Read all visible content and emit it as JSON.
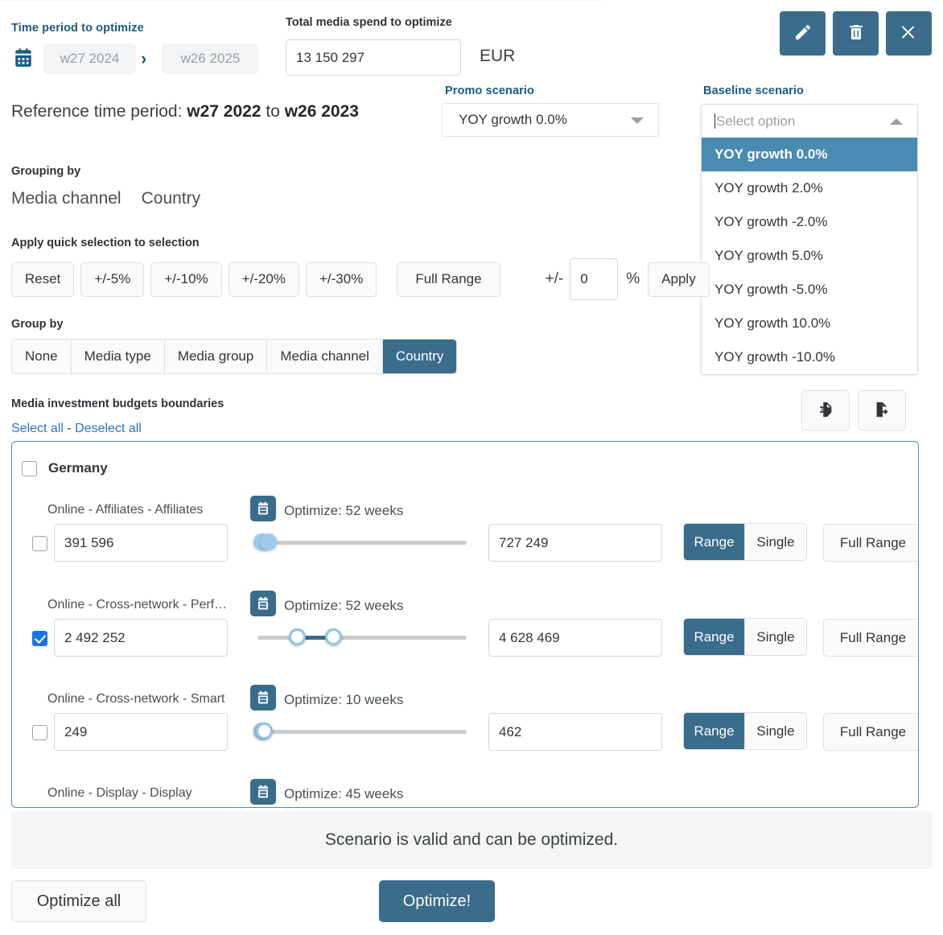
{
  "colors": {
    "accent": "#3a6c8b",
    "accent_light": "#4a8bb1",
    "label_blue": "#1b5b80",
    "link_blue": "#2277cc",
    "checkbox_blue": "#1a73e8",
    "handle_blue": "#8fc4e8"
  },
  "top_actions": [
    {
      "name": "edit-scenario-button",
      "icon": "pencil-icon"
    },
    {
      "name": "delete-scenario-button",
      "icon": "trash-icon"
    },
    {
      "name": "close-button",
      "icon": "close-icon"
    }
  ],
  "time_period": {
    "label": "Time period to optimize",
    "start": "w27 2024",
    "end": "w26 2025",
    "separator": "›",
    "calendar_icon": "calendar-icon",
    "reference_prefix": "Reference time period: ",
    "reference_start": "w27 2022",
    "reference_middle": " to ",
    "reference_end": "w26 2023"
  },
  "spend": {
    "label": "Total media spend to optimize",
    "value": "13 150 297",
    "currency": "EUR"
  },
  "promo": {
    "label": "Promo scenario",
    "value": "YOY growth 0.0%"
  },
  "baseline": {
    "label": "Baseline scenario",
    "placeholder": "Select option",
    "selected_index": 0,
    "options": [
      "YOY growth 0.0%",
      "YOY growth 2.0%",
      "YOY growth -2.0%",
      "YOY growth 5.0%",
      "YOY growth -5.0%",
      "YOY growth 10.0%",
      "YOY growth -10.0%"
    ]
  },
  "grouping": {
    "label": "Grouping by",
    "values": [
      "Media channel",
      "Country"
    ]
  },
  "quick_selection": {
    "label": "Apply quick selection to selection",
    "buttons": [
      "Reset",
      "+/-5%",
      "+/-10%",
      "+/-20%",
      "+/-30%"
    ],
    "full_range_label": "Full Range",
    "pm_sign": "+/-",
    "pm_value": "0",
    "pm_percent": "%",
    "apply_label": "Apply"
  },
  "group_by": {
    "label": "Group by",
    "tabs": [
      "None",
      "Media type",
      "Media group",
      "Media channel",
      "Country"
    ],
    "active_index": 4
  },
  "budgets": {
    "title": "Media investment budgets boundaries",
    "select_all": "Select all",
    "separator": " - ",
    "deselect_all": "Deselect all",
    "import_icon": "import-document-icon",
    "export_icon": "export-document-icon",
    "country": "Germany",
    "country_checked": false,
    "range_label": "Range",
    "single_label": "Single",
    "full_range_label": "Full Range",
    "rows": [
      {
        "name": "Online - Affiliates - Affiliates",
        "optimize": "Optimize: 52 weeks",
        "min": "391 596",
        "max": "727 249",
        "checked": false,
        "mode": "Range",
        "slider_low_pct": 2,
        "slider_high_pct": 5
      },
      {
        "name": "Online - Cross-network - Perf…",
        "optimize": "Optimize: 52 weeks",
        "min": "2 492 252",
        "max": "4 628 469",
        "checked": true,
        "mode": "Range",
        "slider_low_pct": 19,
        "slider_high_pct": 36
      },
      {
        "name": "Online - Cross-network - Smart",
        "optimize": "Optimize: 10 weeks",
        "min": "249",
        "max": "462",
        "checked": false,
        "mode": "Range",
        "slider_low_pct": 2,
        "slider_high_pct": 3
      },
      {
        "name": "Online - Display - Display",
        "optimize": "Optimize: 45 weeks",
        "min": "",
        "max": "",
        "checked": false,
        "mode": "Range",
        "slider_low_pct": 0,
        "slider_high_pct": 0
      }
    ]
  },
  "status": {
    "message": "Scenario is valid and can be optimized."
  },
  "footer": {
    "optimize_all": "Optimize all",
    "optimize": "Optimize!"
  }
}
